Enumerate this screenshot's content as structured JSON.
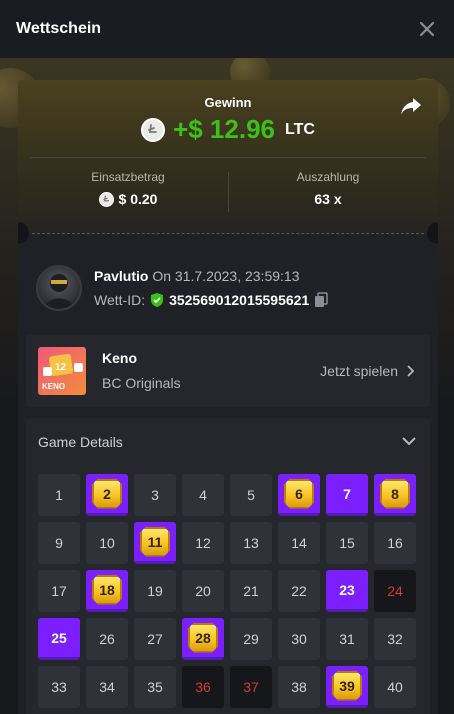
{
  "header": {
    "title": "Wettschein",
    "close_icon": "close-icon"
  },
  "win": {
    "label": "Gewinn",
    "amount": "+$ 12.96",
    "currency": "LTC",
    "amount_color": "#3bc117"
  },
  "stats": {
    "bet_label": "Einsatzbetrag",
    "bet_value": "$ 0.20",
    "payout_label": "Auszahlung",
    "payout_value": "63 x"
  },
  "user": {
    "name": "Pavlutio",
    "time": "On 31.7.2023, 23:59:13",
    "bet_id_label": "Wett-ID:",
    "bet_id": "352569012015595621"
  },
  "game": {
    "name": "Keno",
    "provider": "BC Originals",
    "thumb_label": "KENO",
    "thumb_number": "12",
    "play_label": "Jetzt spielen"
  },
  "details": {
    "title": "Game Details",
    "cells": [
      {
        "n": "1",
        "s": "normal"
      },
      {
        "n": "2",
        "s": "hit"
      },
      {
        "n": "3",
        "s": "normal"
      },
      {
        "n": "4",
        "s": "normal"
      },
      {
        "n": "5",
        "s": "normal"
      },
      {
        "n": "6",
        "s": "hit"
      },
      {
        "n": "7",
        "s": "pick"
      },
      {
        "n": "8",
        "s": "hit"
      },
      {
        "n": "9",
        "s": "normal"
      },
      {
        "n": "10",
        "s": "normal"
      },
      {
        "n": "11",
        "s": "hit"
      },
      {
        "n": "12",
        "s": "normal"
      },
      {
        "n": "13",
        "s": "normal"
      },
      {
        "n": "14",
        "s": "normal"
      },
      {
        "n": "15",
        "s": "normal"
      },
      {
        "n": "16",
        "s": "normal"
      },
      {
        "n": "17",
        "s": "normal"
      },
      {
        "n": "18",
        "s": "hit"
      },
      {
        "n": "19",
        "s": "normal"
      },
      {
        "n": "20",
        "s": "normal"
      },
      {
        "n": "21",
        "s": "normal"
      },
      {
        "n": "22",
        "s": "normal"
      },
      {
        "n": "23",
        "s": "pick"
      },
      {
        "n": "24",
        "s": "miss"
      },
      {
        "n": "25",
        "s": "pick"
      },
      {
        "n": "26",
        "s": "normal"
      },
      {
        "n": "27",
        "s": "normal"
      },
      {
        "n": "28",
        "s": "hit"
      },
      {
        "n": "29",
        "s": "normal"
      },
      {
        "n": "30",
        "s": "normal"
      },
      {
        "n": "31",
        "s": "normal"
      },
      {
        "n": "32",
        "s": "normal"
      },
      {
        "n": "33",
        "s": "normal"
      },
      {
        "n": "34",
        "s": "normal"
      },
      {
        "n": "35",
        "s": "normal"
      },
      {
        "n": "36",
        "s": "miss"
      },
      {
        "n": "37",
        "s": "miss"
      },
      {
        "n": "38",
        "s": "normal"
      },
      {
        "n": "39",
        "s": "hit"
      },
      {
        "n": "40",
        "s": "normal"
      }
    ]
  }
}
